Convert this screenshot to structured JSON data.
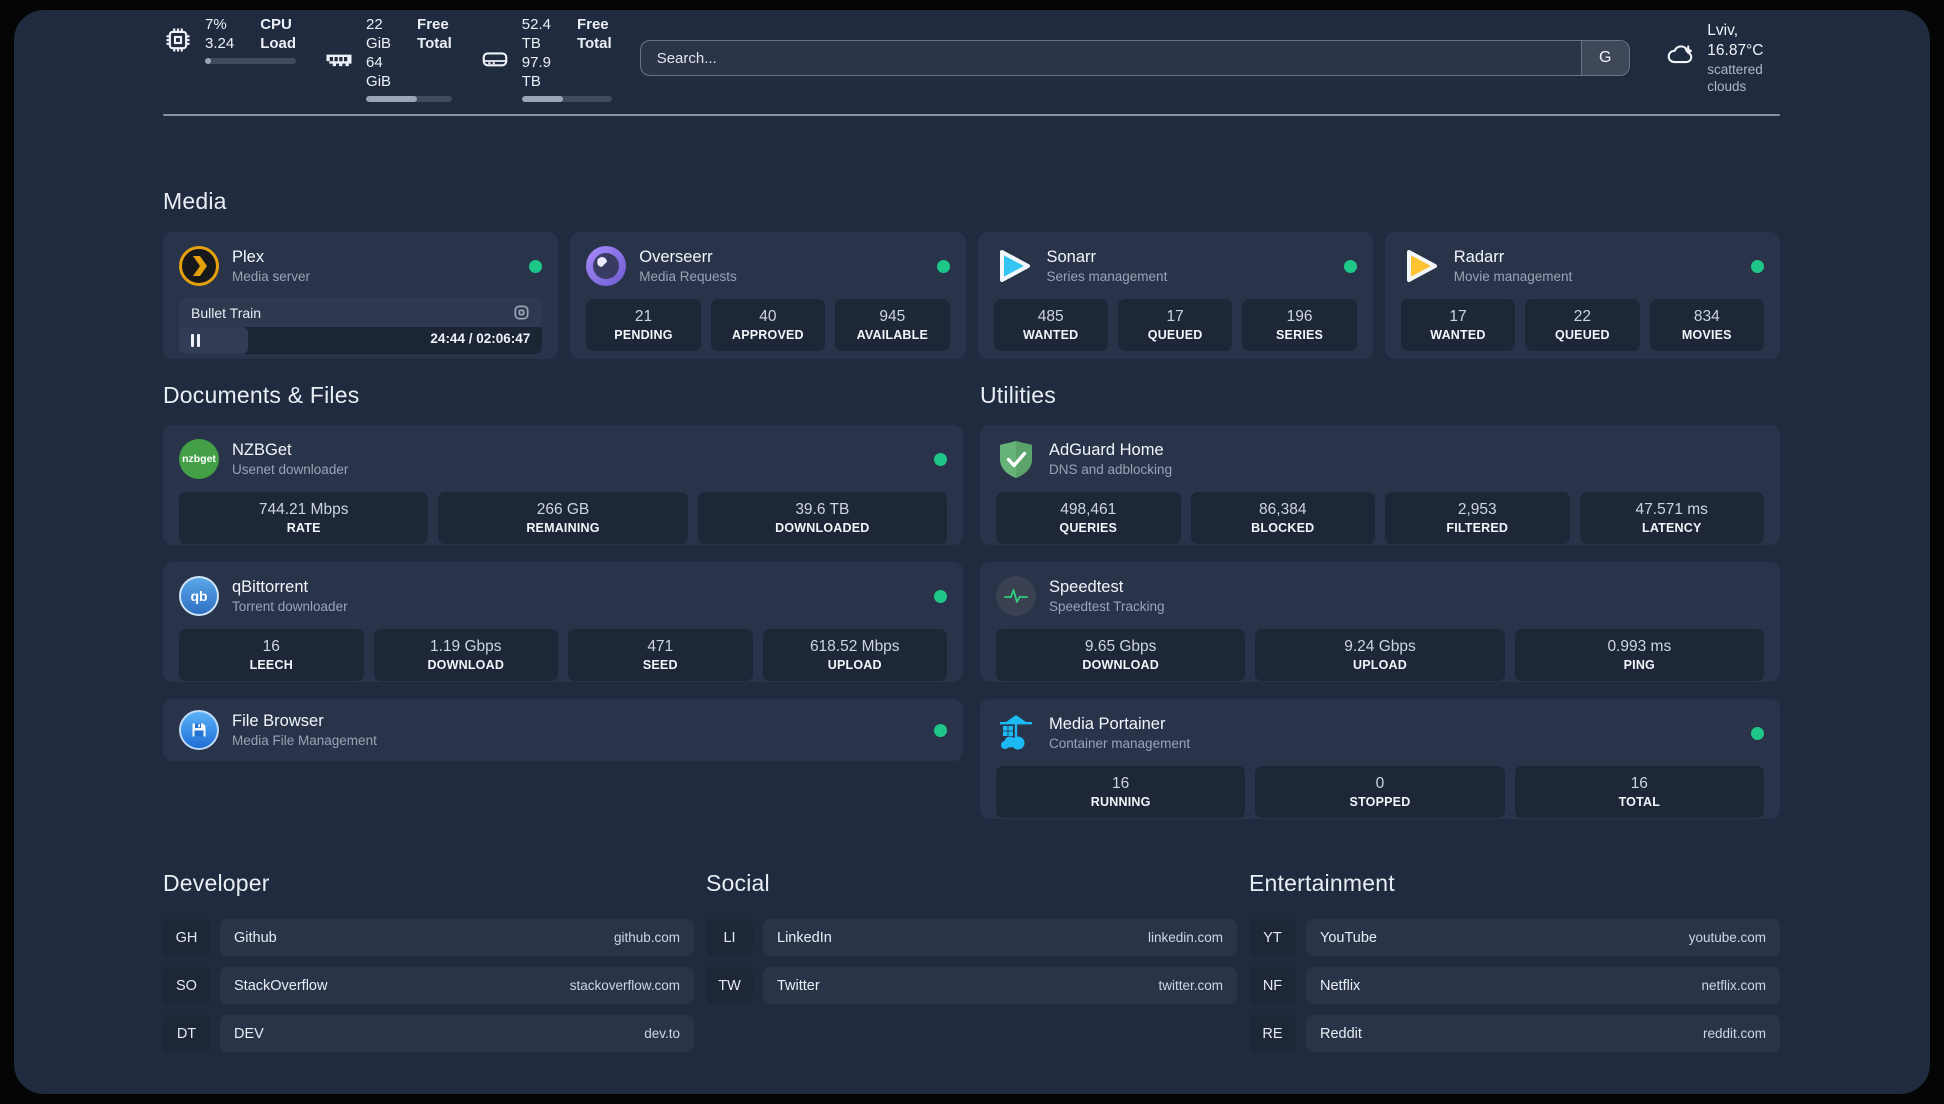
{
  "header": {
    "stats": [
      {
        "icon": "cpu-icon",
        "values": [
          "7%",
          "3.24"
        ],
        "labels": [
          "CPU",
          "Load"
        ],
        "progress": 7
      },
      {
        "icon": "ram-icon",
        "values": [
          "22 GiB",
          "64 GiB"
        ],
        "labels": [
          "Free",
          "Total"
        ],
        "progress": 60
      },
      {
        "icon": "disk-icon",
        "values": [
          "52.4 TB",
          "97.9 TB"
        ],
        "labels": [
          "Free",
          "Total"
        ],
        "progress": 46
      }
    ],
    "search": {
      "placeholder": "Search...",
      "engine_button": "G"
    },
    "weather": {
      "location_temp": "Lviv, 16.87°C",
      "condition": "scattered clouds"
    }
  },
  "media": {
    "title": "Media",
    "apps": [
      {
        "icon": "plex-icon",
        "name": "Plex",
        "desc": "Media server",
        "online": true,
        "player": {
          "title": "Bullet Train",
          "time": "24:44 / 02:06:47",
          "progress": 19
        }
      },
      {
        "icon": "overseerr-icon",
        "name": "Overseerr",
        "desc": "Media Requests",
        "online": true,
        "stats": [
          {
            "value": "21",
            "label": "PENDING"
          },
          {
            "value": "40",
            "label": "APPROVED"
          },
          {
            "value": "945",
            "label": "AVAILABLE"
          }
        ]
      },
      {
        "icon": "sonarr-icon",
        "name": "Sonarr",
        "desc": "Series management",
        "online": true,
        "stats": [
          {
            "value": "485",
            "label": "WANTED"
          },
          {
            "value": "17",
            "label": "QUEUED"
          },
          {
            "value": "196",
            "label": "SERIES"
          }
        ]
      },
      {
        "icon": "radarr-icon",
        "name": "Radarr",
        "desc": "Movie management",
        "online": true,
        "stats": [
          {
            "value": "17",
            "label": "WANTED"
          },
          {
            "value": "22",
            "label": "QUEUED"
          },
          {
            "value": "834",
            "label": "MOVIES"
          }
        ]
      }
    ]
  },
  "documents": {
    "title": "Documents & Files",
    "apps": [
      {
        "icon": "nzbget-icon",
        "name": "NZBGet",
        "desc": "Usenet downloader",
        "online": true,
        "stats": [
          {
            "value": "744.21 Mbps",
            "label": "RATE"
          },
          {
            "value": "266 GB",
            "label": "REMAINING"
          },
          {
            "value": "39.6 TB",
            "label": "DOWNLOADED"
          }
        ]
      },
      {
        "icon": "qbittorrent-icon",
        "name": "qBittorrent",
        "desc": "Torrent downloader",
        "online": true,
        "stats": [
          {
            "value": "16",
            "label": "LEECH"
          },
          {
            "value": "1.19 Gbps",
            "label": "DOWNLOAD"
          },
          {
            "value": "471",
            "label": "SEED"
          },
          {
            "value": "618.52 Mbps",
            "label": "UPLOAD"
          }
        ]
      },
      {
        "icon": "filebrowser-icon",
        "name": "File Browser",
        "desc": "Media File Management",
        "online": true,
        "stats": []
      }
    ]
  },
  "utilities": {
    "title": "Utilities",
    "apps": [
      {
        "icon": "adguard-icon",
        "name": "AdGuard Home",
        "desc": "DNS and adblocking",
        "online": false,
        "stats": [
          {
            "value": "498,461",
            "label": "QUERIES"
          },
          {
            "value": "86,384",
            "label": "BLOCKED"
          },
          {
            "value": "2,953",
            "label": "FILTERED"
          },
          {
            "value": "47.571 ms",
            "label": "LATENCY"
          }
        ]
      },
      {
        "icon": "speedtest-icon",
        "name": "Speedtest",
        "desc": "Speedtest Tracking",
        "online": false,
        "stats": [
          {
            "value": "9.65 Gbps",
            "label": "DOWNLOAD"
          },
          {
            "value": "9.24 Gbps",
            "label": "UPLOAD"
          },
          {
            "value": "0.993 ms",
            "label": "PING"
          }
        ]
      },
      {
        "icon": "portainer-icon",
        "name": "Media Portainer",
        "desc": "Container management",
        "online": true,
        "stats": [
          {
            "value": "16",
            "label": "RUNNING"
          },
          {
            "value": "0",
            "label": "STOPPED"
          },
          {
            "value": "16",
            "label": "TOTAL"
          }
        ]
      }
    ]
  },
  "bookmarks": {
    "developer": {
      "title": "Developer",
      "items": [
        {
          "abbr": "GH",
          "name": "Github",
          "url": "github.com"
        },
        {
          "abbr": "SO",
          "name": "StackOverflow",
          "url": "stackoverflow.com"
        },
        {
          "abbr": "DT",
          "name": "DEV",
          "url": "dev.to"
        }
      ]
    },
    "social": {
      "title": "Social",
      "items": [
        {
          "abbr": "LI",
          "name": "LinkedIn",
          "url": "linkedin.com"
        },
        {
          "abbr": "TW",
          "name": "Twitter",
          "url": "twitter.com"
        }
      ]
    },
    "entertainment": {
      "title": "Entertainment",
      "items": [
        {
          "abbr": "YT",
          "name": "YouTube",
          "url": "youtube.com"
        },
        {
          "abbr": "NF",
          "name": "Netflix",
          "url": "netflix.com"
        },
        {
          "abbr": "RE",
          "name": "Reddit",
          "url": "reddit.com"
        }
      ]
    }
  },
  "colors": {
    "status_online": "#1ec787",
    "accent_plex": "#e5a00d",
    "accent_sonarr": "#35c5f4",
    "accent_radarr": "#ffc230"
  }
}
